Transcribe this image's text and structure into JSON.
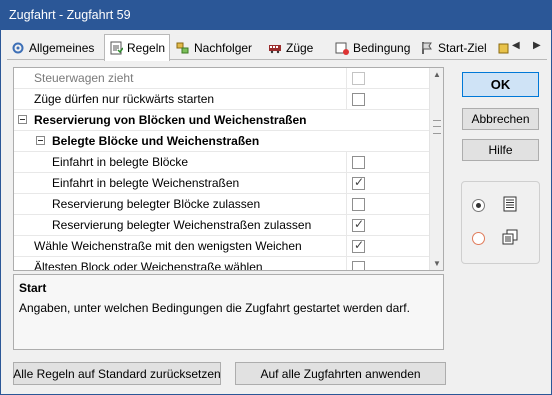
{
  "window": {
    "title": "Zugfahrt - Zugfahrt 59"
  },
  "tabs": [
    {
      "label": "Allgemeines",
      "icon": "general-settings-icon",
      "active": false
    },
    {
      "label": "Regeln",
      "icon": "rules-icon",
      "active": true
    },
    {
      "label": "Nachfolger",
      "icon": "successor-icon",
      "active": false
    },
    {
      "label": "Züge",
      "icon": "train-icon",
      "active": false
    },
    {
      "label": "Bedingung",
      "icon": "condition-icon",
      "active": false
    },
    {
      "label": "Start-Ziel",
      "icon": "start-target-icon",
      "active": false
    }
  ],
  "rules": [
    {
      "label": "Steuerwagen zieht",
      "checked": false,
      "muted": true
    },
    {
      "label": "Züge dürfen nur rückwärts starten",
      "checked": false
    },
    {
      "label": "Reservierung von Blöcken und Weichenstraßen",
      "header": true,
      "level": 0
    },
    {
      "label": "Belegte Blöcke und Weichenstraßen",
      "header": true,
      "level": 1
    },
    {
      "label": "Einfahrt in belegte Blöcke",
      "checked": false
    },
    {
      "label": "Einfahrt in belegte Weichenstraßen",
      "checked": true
    },
    {
      "label": "Reservierung belegter Blöcke zulassen",
      "checked": false
    },
    {
      "label": "Reservierung belegter Weichenstraßen zulassen",
      "checked": true
    },
    {
      "label": "Wähle Weichenstraße mit den wenigsten Weichen",
      "checked": true
    },
    {
      "label": "Ältesten Block oder Weichenstraße wählen",
      "checked": false
    }
  ],
  "description": {
    "title": "Start",
    "text": "Angaben, unter welchen Bedingungen die Zugfahrt gestartet werden darf."
  },
  "buttons": {
    "ok": "OK",
    "cancel": "Abbrechen",
    "help": "Hilfe",
    "reset": "Alle Regeln auf Standard zurücksetzen",
    "apply_all": "Auf alle Zugfahrten anwenden"
  },
  "view_options": [
    {
      "icon": "list-view-icon",
      "selected": true
    },
    {
      "icon": "grouped-view-icon",
      "selected": false
    }
  ]
}
